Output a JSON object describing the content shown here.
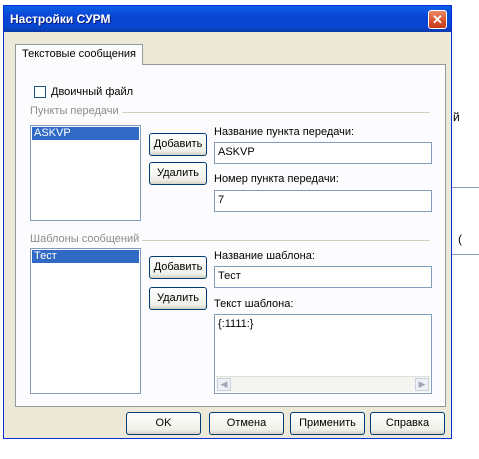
{
  "window": {
    "title": "Настройки СУРМ",
    "close_glyph": "✕"
  },
  "tabs": [
    {
      "label": "Текстовые сообщения",
      "active": true
    }
  ],
  "binary_file": {
    "label": "Двоичный файл",
    "checked": false
  },
  "points": {
    "group_label": "Пункты передачи",
    "items": [
      "ASKVP"
    ],
    "selected": "ASKVP",
    "add_label": "Добавить",
    "delete_label": "Удалить",
    "name_label": "Название пункта передачи:",
    "name_value": "ASKVP",
    "number_label": "Номер пункта передачи:",
    "number_value": "7"
  },
  "templates": {
    "group_label": "Шаблоны сообщений",
    "items": [
      "Тест"
    ],
    "selected": "Тест",
    "add_label": "Добавить",
    "delete_label": "Удалить",
    "name_label": "Название шаблона:",
    "name_value": "Тест",
    "text_label": "Текст шаблона:",
    "text_value": "{:1111:}"
  },
  "footer": {
    "ok_label": "OK",
    "cancel_label": "Отмена",
    "apply_label": "Применить",
    "help_label": "Справка"
  },
  "background": {
    "fragment_1": "й",
    "fragment_2": "("
  }
}
